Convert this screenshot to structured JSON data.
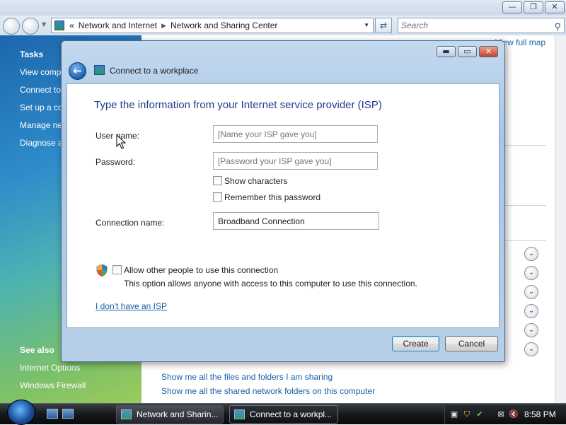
{
  "explorer": {
    "address": {
      "prefix": "«",
      "crumbs": [
        "Network and Internet",
        "Network and Sharing Center"
      ]
    },
    "search_placeholder": "Search",
    "view_full_map": "View full map",
    "tasks_heading": "Tasks",
    "tasks": [
      "View comp",
      "Connect to",
      "Set up a co",
      "Manage ne",
      "Diagnose a"
    ],
    "see_also_heading": "See also",
    "see_also": [
      "Internet Options",
      "Windows Firewall"
    ],
    "share_links": [
      "Show me all the files and folders I am sharing",
      "Show me all the shared network folders on this computer"
    ]
  },
  "dialog": {
    "title": "Connect to a workplace",
    "heading": "Type the information from your Internet service provider (ISP)",
    "username_label": "User name:",
    "username_placeholder": "[Name your ISP gave you]",
    "password_label": "Password:",
    "password_placeholder": "[Password your ISP gave you]",
    "show_characters": "Show characters",
    "remember_password": "Remember this password",
    "connection_name_label": "Connection name:",
    "connection_name_value": "Broadband Connection",
    "allow_others": "Allow other people to use this connection",
    "allow_others_desc": "This option allows anyone with access to this computer to use this connection.",
    "no_isp_link": "I don't have an ISP",
    "create_button": "Create",
    "cancel_button": "Cancel"
  },
  "taskbar": {
    "items": [
      "Network and Sharin...",
      "Connect to a workpl..."
    ],
    "clock": "8:58 PM"
  },
  "colors": {
    "heading_blue": "#1d3d8a",
    "link_blue": "#1560a8"
  }
}
